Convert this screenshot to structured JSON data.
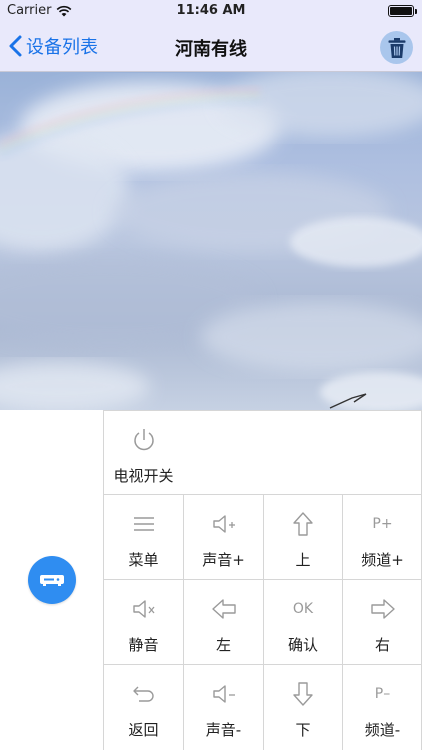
{
  "status_bar": {
    "carrier": "Carrier",
    "time": "11:46 AM",
    "icons": [
      "wifi-icon",
      "battery-icon"
    ]
  },
  "nav_bar": {
    "back_label": "设备列表",
    "title": "河南有线",
    "icons": [
      "chevron-left-icon",
      "trash-icon"
    ]
  },
  "colors": {
    "accent": "#1a73e8",
    "device_button": "#2f8df1",
    "nav_background": "#e9e9fb",
    "icon_gray": "#9a9a9a"
  },
  "remote": {
    "power": {
      "label": "电视开关",
      "icon": "power-icon"
    },
    "menu": {
      "label": "菜单",
      "icon": "menu-icon"
    },
    "volume_up": {
      "label": "声音+",
      "icon": "volume-up-icon"
    },
    "up": {
      "label": "上",
      "icon": "arrow-up-icon"
    },
    "channel_up": {
      "label": "频道+",
      "icon_text": "P+",
      "icon": "channel-up-icon"
    },
    "mute": {
      "label": "静音",
      "icon": "mute-icon"
    },
    "left": {
      "label": "左",
      "icon": "arrow-left-icon"
    },
    "ok": {
      "label": "确认",
      "icon_text": "OK",
      "icon": "ok-icon"
    },
    "right": {
      "label": "右",
      "icon": "arrow-right-icon"
    },
    "back": {
      "label": "返回",
      "icon": "return-icon"
    },
    "volume_down": {
      "label": "声音-",
      "icon": "volume-down-icon"
    },
    "down": {
      "label": "下",
      "icon": "arrow-down-icon"
    },
    "channel_down": {
      "label": "频道-",
      "icon_text": "P–",
      "icon": "channel-down-icon"
    }
  },
  "device_button": {
    "icon": "set-top-box-icon"
  }
}
